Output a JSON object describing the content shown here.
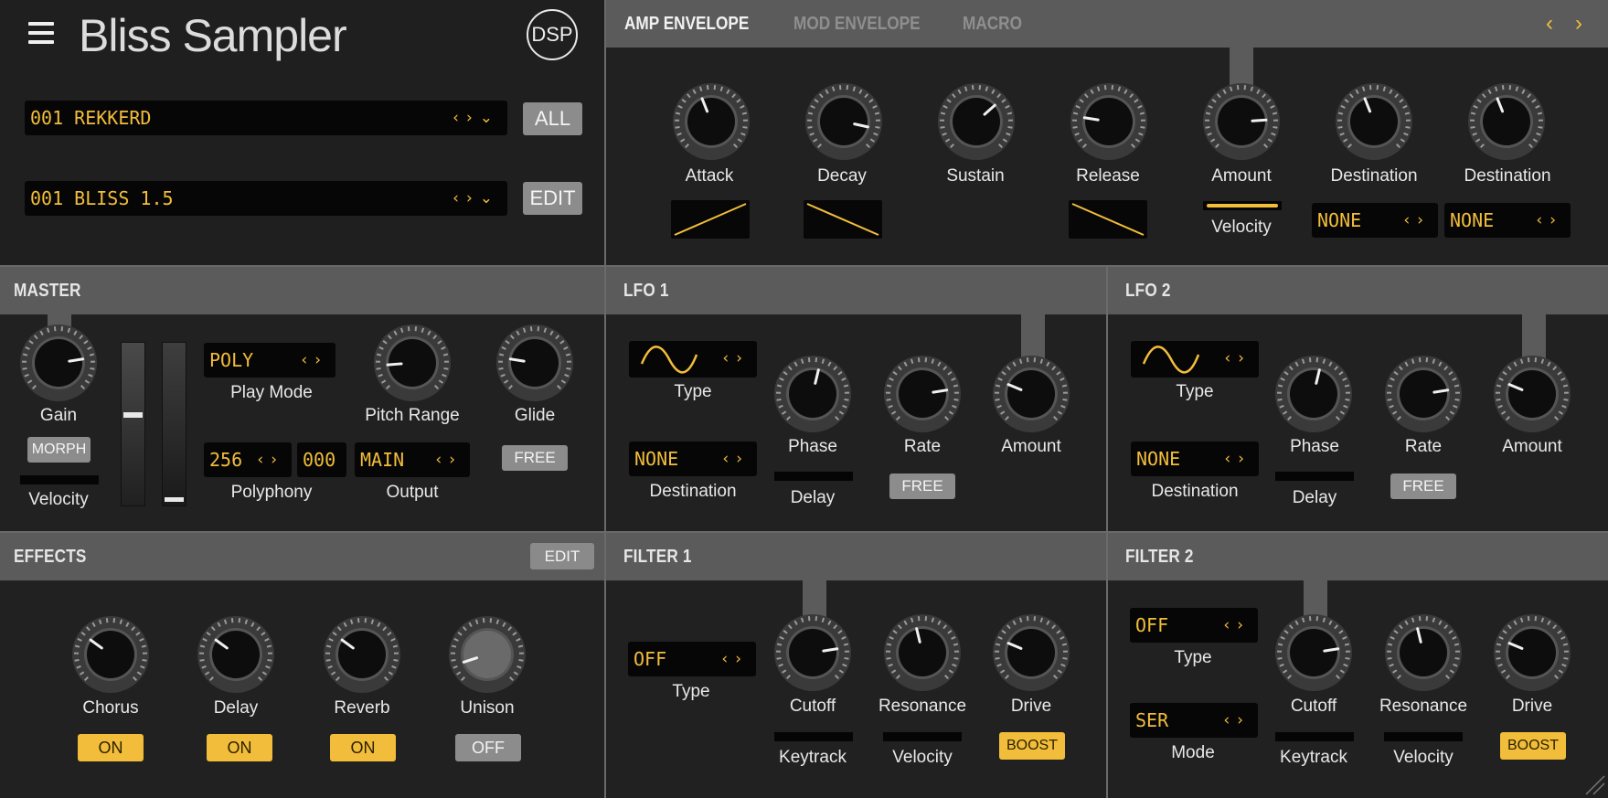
{
  "app": {
    "title": "Bliss Sampler",
    "dsp_label": "DSP"
  },
  "presets": {
    "bank": {
      "value": "001 REKKERD",
      "button": "ALL"
    },
    "program": {
      "value": "001 BLISS 1.5",
      "button": "EDIT"
    }
  },
  "tabs": {
    "items": [
      "AMP ENVELOPE",
      "MOD ENVELOPE",
      "MACRO"
    ],
    "active": "AMP ENVELOPE"
  },
  "amp_envelope": {
    "knobs": [
      "Attack",
      "Decay",
      "Sustain",
      "Release",
      "Amount",
      "Destination",
      "Destination"
    ],
    "velocity_label": "Velocity",
    "destinations": [
      "NONE",
      "NONE"
    ]
  },
  "master": {
    "title": "MASTER",
    "gain_label": "Gain",
    "morph_button": "MORPH",
    "velocity_label": "Velocity",
    "play_mode": {
      "value": "POLY",
      "label": "Play Mode"
    },
    "polyphony": {
      "value": "256",
      "extra": "000",
      "label": "Polyphony"
    },
    "output": {
      "value": "MAIN",
      "label": "Output"
    },
    "pitch_range_label": "Pitch Range",
    "glide_label": "Glide",
    "glide_button": "FREE"
  },
  "lfo1": {
    "title": "LFO 1",
    "type_label": "Type",
    "destination": "NONE",
    "destination_label": "Destination",
    "phase_label": "Phase",
    "delay_label": "Delay",
    "rate_label": "Rate",
    "rate_button": "FREE",
    "amount_label": "Amount"
  },
  "lfo2": {
    "title": "LFO 2",
    "type_label": "Type",
    "destination": "NONE",
    "destination_label": "Destination",
    "phase_label": "Phase",
    "delay_label": "Delay",
    "rate_label": "Rate",
    "rate_button": "FREE",
    "amount_label": "Amount"
  },
  "effects": {
    "title": "EFFECTS",
    "edit_button": "EDIT",
    "items": [
      {
        "label": "Chorus",
        "state": "ON"
      },
      {
        "label": "Delay",
        "state": "ON"
      },
      {
        "label": "Reverb",
        "state": "ON"
      },
      {
        "label": "Unison",
        "state": "OFF"
      }
    ]
  },
  "filter1": {
    "title": "FILTER 1",
    "type": "OFF",
    "type_label": "Type",
    "cutoff_label": "Cutoff",
    "keytrack_label": "Keytrack",
    "resonance_label": "Resonance",
    "velocity_label": "Velocity",
    "drive_label": "Drive",
    "boost_button": "BOOST"
  },
  "filter2": {
    "title": "FILTER 2",
    "type": "OFF",
    "type_label": "Type",
    "mode": "SER",
    "mode_label": "Mode",
    "cutoff_label": "Cutoff",
    "keytrack_label": "Keytrack",
    "resonance_label": "Resonance",
    "velocity_label": "Velocity",
    "drive_label": "Drive",
    "boost_button": "BOOST"
  },
  "colors": {
    "accent": "#f2bd3a",
    "header": "#5b5b5b",
    "panel": "#212121",
    "lcd": "#060606"
  }
}
